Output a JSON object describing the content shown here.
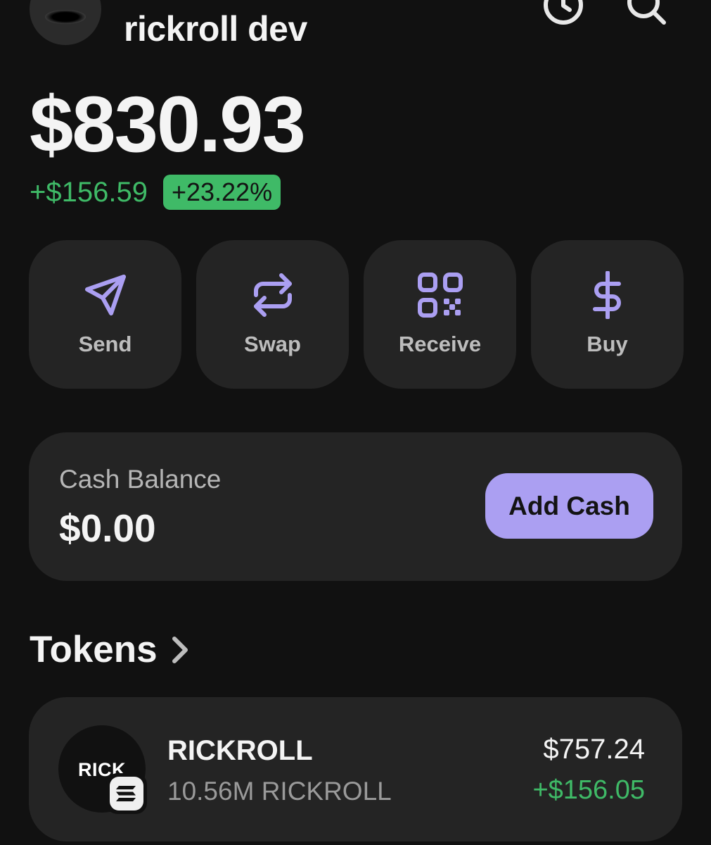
{
  "header": {
    "wallet_name": "rickroll dev"
  },
  "portfolio": {
    "balance": "$830.93",
    "change_amount": "+$156.59",
    "change_percent": "+23.22%"
  },
  "actions": [
    {
      "label": "Send",
      "icon": "send-icon"
    },
    {
      "label": "Swap",
      "icon": "swap-icon"
    },
    {
      "label": "Receive",
      "icon": "qr-code-icon"
    },
    {
      "label": "Buy",
      "icon": "dollar-icon"
    }
  ],
  "cash": {
    "label": "Cash Balance",
    "amount": "$0.00",
    "button_label": "Add Cash"
  },
  "tokens": {
    "title": "Tokens",
    "items": [
      {
        "logo_text": "RICK",
        "name": "RICKROLL",
        "amount": "10.56M RICKROLL",
        "value": "$757.24",
        "change": "+$156.05"
      }
    ]
  },
  "colors": {
    "background": "#111111",
    "card": "#242424",
    "accent": "#ab9ff2",
    "positive": "#3fba67"
  }
}
